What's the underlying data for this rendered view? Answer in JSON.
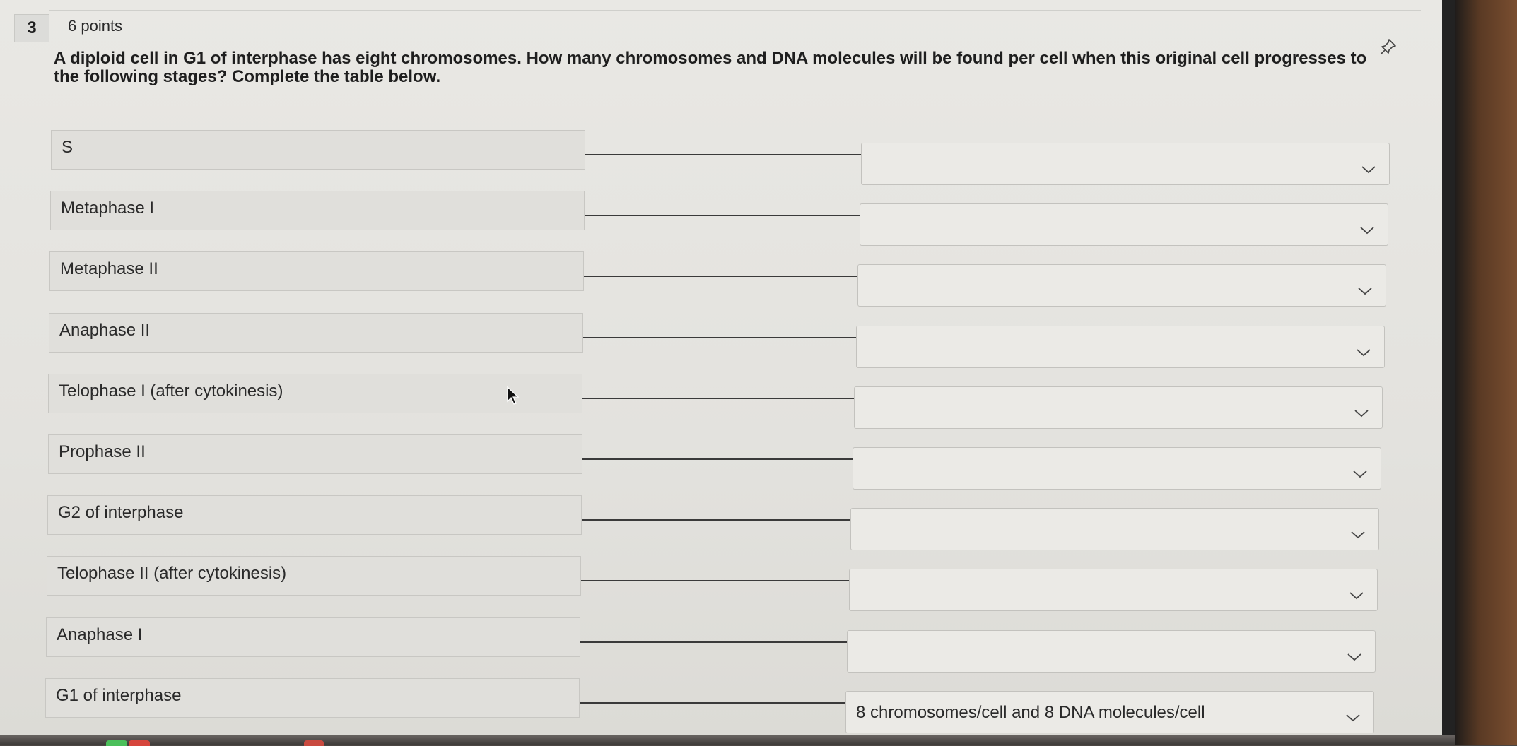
{
  "question": {
    "number": "3",
    "points": "6 points",
    "text": "A diploid cell in G1 of interphase has eight chromosomes. How many chromosomes and DNA molecules will be found per cell when this original cell progresses to the following stages? Complete the table below."
  },
  "rows": [
    {
      "label": "S",
      "answer": ""
    },
    {
      "label": "Metaphase I",
      "answer": ""
    },
    {
      "label": "Metaphase II",
      "answer": ""
    },
    {
      "label": "Anaphase II",
      "answer": ""
    },
    {
      "label": "Telophase I (after cytokinesis)",
      "answer": ""
    },
    {
      "label": "Prophase II",
      "answer": ""
    },
    {
      "label": "G2 of interphase",
      "answer": ""
    },
    {
      "label": "Telophase II (after cytokinesis)",
      "answer": ""
    },
    {
      "label": "Anaphase I",
      "answer": ""
    },
    {
      "label": "G1 of interphase",
      "answer": "8 chromosomes/cell and 8 DNA molecules/cell"
    }
  ],
  "icons": {
    "pin": "pin-icon",
    "chevron": "chevron-down-icon",
    "cursor": "mouse-cursor-icon"
  }
}
